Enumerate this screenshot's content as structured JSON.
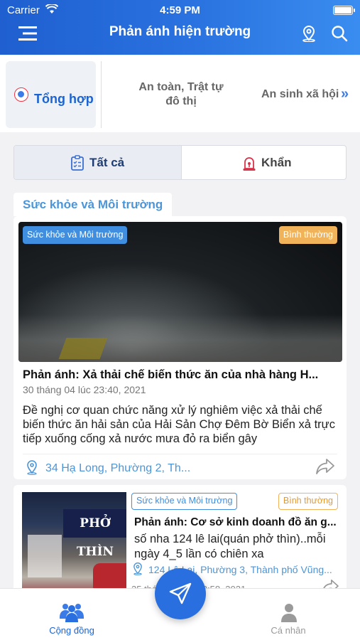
{
  "status_bar": {
    "carrier": "Carrier",
    "time": "4:59 PM"
  },
  "header": {
    "title": "Phản ánh hiện trường"
  },
  "categories": {
    "active": "Tổng hợp",
    "second_line1": "An toàn, Trật tự",
    "second_line2": "đô thị",
    "third": "An sinh xã hội",
    "more": "»"
  },
  "filter_tabs": {
    "all": "Tất cả",
    "urgent": "Khẩn",
    "selected": "Tất cả"
  },
  "section": {
    "label": "Sức khỏe và Môi trường"
  },
  "posts": [
    {
      "category": "Sức khỏe và Môi trường",
      "priority": "Bình thường",
      "title": "Phản ánh: Xả thải chế biến thức ăn của nhà hàng H...",
      "date": "30 tháng 04 lúc 23:40, 2021",
      "description": "Đề nghị cơ quan chức năng xử lý nghiêm việc xả thải chế biến thức ăn hải sản của Hải Sản Chợ Đêm Bờ Biển xả trực tiếp xuống cống xả nước mưa đỏ ra biển gây",
      "location": "34 Hạ Long, Phường 2, Th..."
    },
    {
      "category": "Sức khỏe và Môi trường",
      "priority": "Bình thường",
      "title": "Phản ánh: Cơ sở kinh doanh đồ ăn g...",
      "description": "số nha 124 lê lai(quán phở thìn)..mỗi ngày 4_5 lần có chiên xa",
      "location": "124 Lê Lai, Phường 3, Thành phố Vũng...",
      "date": "25 tháng 04 lúc 18:58, 2021",
      "image_sign": "PHỞ THÌN"
    }
  ],
  "bottom_nav": {
    "community": "Cộng đồng",
    "personal": "Cá nhân",
    "active": "Cộng đồng"
  },
  "colors": {
    "primary": "#2a6fe0",
    "accent_text": "#4b95d8",
    "priority": "#f0b35a"
  }
}
